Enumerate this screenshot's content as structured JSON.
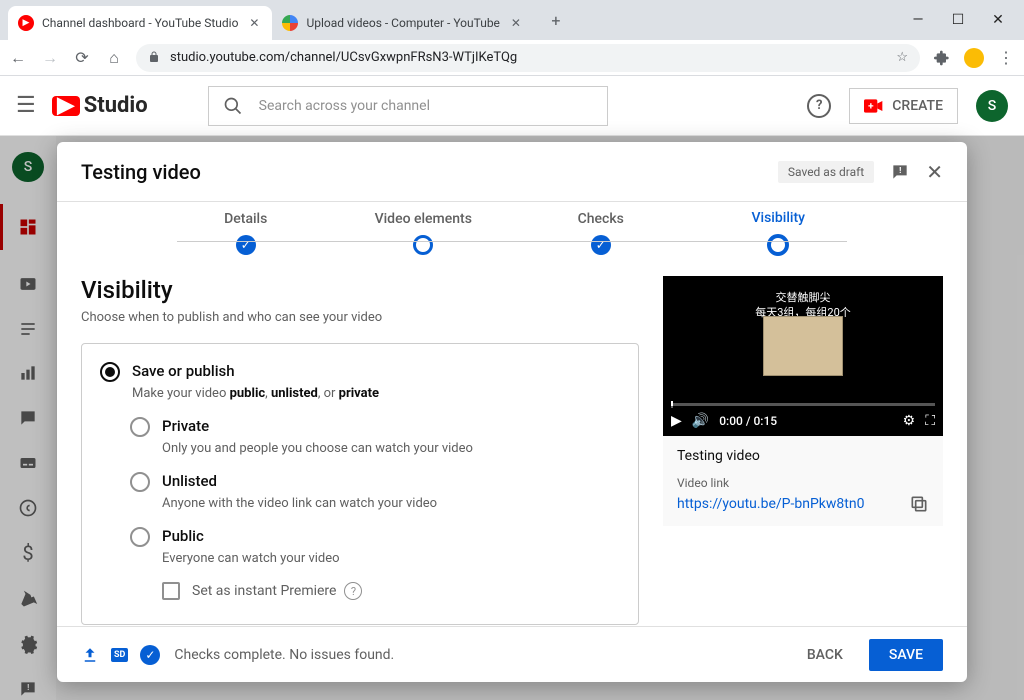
{
  "browser": {
    "tabs": [
      {
        "title": "Channel dashboard - YouTube Studio",
        "active": true
      },
      {
        "title": "Upload videos - Computer - YouTube",
        "active": false
      }
    ],
    "url": "studio.youtube.com/channel/UCsvGxwpnFRsN3-WTjIKeTQg"
  },
  "header": {
    "logo_text": "Studio",
    "search_placeholder": "Search across your channel",
    "create_label": "CREATE",
    "avatar_letter": "S"
  },
  "modal": {
    "title": "Testing video",
    "saved_chip": "Saved as draft",
    "stepper": [
      "Details",
      "Video elements",
      "Checks",
      "Visibility"
    ],
    "section": {
      "title": "Visibility",
      "subtitle": "Choose when to publish and who can see your video"
    },
    "save_or_publish": {
      "title": "Save or publish",
      "desc_prefix": "Make your video ",
      "desc_bold1": "public",
      "desc_mid1": ", ",
      "desc_bold2": "unlisted",
      "desc_mid2": ", or ",
      "desc_bold3": "private"
    },
    "options": {
      "private": {
        "title": "Private",
        "desc": "Only you and people you choose can watch your video"
      },
      "unlisted": {
        "title": "Unlisted",
        "desc": "Anyone with the video link can watch your video"
      },
      "public": {
        "title": "Public",
        "desc": "Everyone can watch your video",
        "premiere": "Set as instant Premiere"
      }
    },
    "preview": {
      "time": "0:00 / 0:15",
      "overlay_line1": "交替触脚尖",
      "overlay_line2": "每天3组，每组20个",
      "title": "Testing video",
      "link_label": "Video link",
      "link": "https://youtu.be/P-bnPkw8tn0"
    },
    "footer": {
      "status": "Checks complete. No issues found.",
      "back": "BACK",
      "save": "SAVE"
    }
  }
}
